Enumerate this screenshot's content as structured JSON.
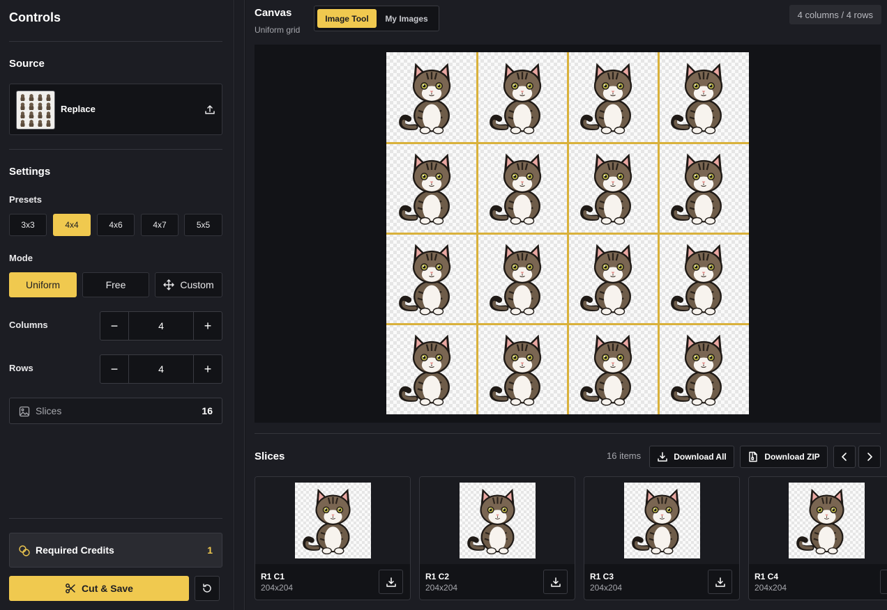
{
  "sidebar": {
    "title": "Controls",
    "source": {
      "heading": "Source",
      "replace_label": "Replace"
    },
    "settings": {
      "heading": "Settings",
      "presets_label": "Presets",
      "presets": [
        "3x3",
        "4x4",
        "4x6",
        "4x7",
        "5x5"
      ],
      "active_preset": "4x4",
      "mode_label": "Mode",
      "modes": [
        "Uniform",
        "Free",
        "Custom"
      ],
      "active_mode": "Uniform",
      "columns_label": "Columns",
      "columns_value": "4",
      "rows_label": "Rows",
      "rows_value": "4",
      "slices_label": "Slices",
      "slices_count": "16"
    },
    "credits": {
      "label": "Required Credits",
      "value": "1"
    },
    "cut_save_label": "Cut & Save"
  },
  "canvas": {
    "title": "Canvas",
    "subtitle": "Uniform grid",
    "tabs": [
      "Image Tool",
      "My Images"
    ],
    "active_tab": "Image Tool",
    "dims_badge": "4 columns / 4 rows",
    "grid": {
      "columns": 4,
      "rows": 4
    }
  },
  "slices": {
    "title": "Slices",
    "count_label": "16 items",
    "download_all_label": "Download All",
    "download_zip_label": "Download ZIP",
    "items": [
      {
        "name": "R1 C1",
        "size": "204x204"
      },
      {
        "name": "R1 C2",
        "size": "204x204"
      },
      {
        "name": "R1 C3",
        "size": "204x204"
      },
      {
        "name": "R1 C4",
        "size": "204x204"
      }
    ]
  },
  "colors": {
    "accent": "#f0c94f",
    "background": "#1c1d23",
    "panel": "#121317"
  }
}
